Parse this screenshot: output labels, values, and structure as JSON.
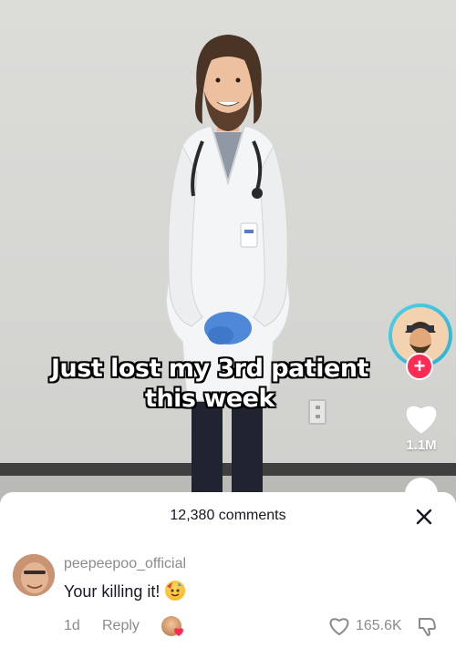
{
  "video": {
    "caption_line1": "Just lost my 3rd patient",
    "caption_line2": "this week",
    "like_count": "1.1M",
    "follow_icon": "plus-icon",
    "like_icon": "heart-icon"
  },
  "comments_sheet": {
    "count_label": "12,380 comments",
    "close_icon": "close-icon",
    "comments": [
      {
        "username": "peepeepoo_official",
        "text": "Your killing it!",
        "emoji": "partying-face-emoji",
        "age": "1d",
        "reply_label": "Reply",
        "likes": "165.6K"
      }
    ]
  },
  "colors": {
    "accent_red": "#fe2c55",
    "avatar_ring": "#2bb0d4",
    "text_primary": "#161823",
    "text_secondary": "#8a8b91"
  }
}
